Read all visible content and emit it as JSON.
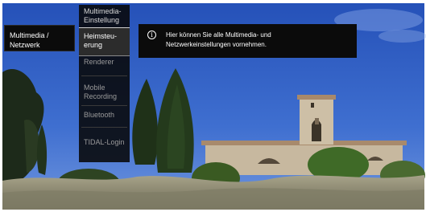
{
  "category": {
    "line1": "Multimedia /",
    "line2": "Netzwerk"
  },
  "menu": {
    "header_line1": "Multimedia-",
    "header_line2": "Einstellung",
    "items": [
      {
        "line1": "Heimsteu-",
        "line2": "erung",
        "selected": true
      },
      {
        "line1": "Renderer",
        "line2": ""
      },
      {
        "line1": "Mobile",
        "line2": "Recording"
      },
      {
        "line1": "Bluetooth",
        "line2": ""
      },
      {
        "line1": "TIDAL-Login",
        "line2": ""
      }
    ]
  },
  "tooltip": {
    "icon": "info-icon",
    "line1": "Hier können Sie alle Multimedia- und",
    "line2": "Netzwerkeinstellungen vornehmen."
  },
  "colors": {
    "panel": "#0b0b0b",
    "selected": "#2c2c2c",
    "inactive_text": "#9a9a9a",
    "sky": "#2d58c0"
  }
}
